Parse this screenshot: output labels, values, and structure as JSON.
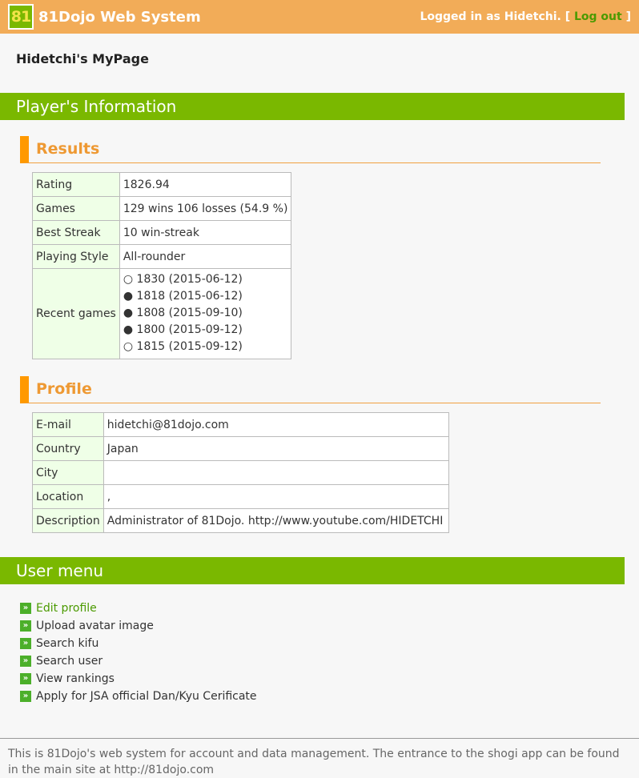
{
  "header": {
    "logo_text": "81",
    "title": "81Dojo Web System",
    "login_prefix": "Logged in as Hidetchi. [",
    "logout_label": "Log out",
    "login_suffix": "]"
  },
  "page_title": "Hidetchi's MyPage",
  "players_info": {
    "section_title": "Player's Information",
    "results": {
      "heading": "Results",
      "rows": {
        "rating": {
          "label": "Rating",
          "value": "1826.94"
        },
        "games": {
          "label": "Games",
          "value": "129 wins 106 losses (54.9 %)"
        },
        "best_streak": {
          "label": "Best Streak",
          "value": "10 win-streak"
        },
        "playing_style": {
          "label": "Playing Style",
          "value": "All-rounder"
        },
        "recent_games": {
          "label": "Recent games",
          "items": [
            {
              "result": "○",
              "text": "1830 (2015-06-12)"
            },
            {
              "result": "●",
              "text": "1818 (2015-06-12)"
            },
            {
              "result": "●",
              "text": "1808 (2015-09-10)"
            },
            {
              "result": "●",
              "text": "1800 (2015-09-12)"
            },
            {
              "result": "○",
              "text": "1815 (2015-09-12)"
            }
          ]
        }
      }
    },
    "profile": {
      "heading": "Profile",
      "rows": {
        "email": {
          "label": "E-mail",
          "value": "hidetchi@81dojo.com"
        },
        "country": {
          "label": "Country",
          "value": "Japan"
        },
        "city": {
          "label": "City",
          "value": ""
        },
        "location": {
          "label": "Location",
          "value": ","
        },
        "description": {
          "label": "Description",
          "value": "Administrator of 81Dojo. http://www.youtube.com/HIDETCHI"
        }
      }
    }
  },
  "user_menu": {
    "section_title": "User menu",
    "items": [
      {
        "label": "Edit profile"
      },
      {
        "label": "Upload avatar image"
      },
      {
        "label": "Search kifu"
      },
      {
        "label": "Search user"
      },
      {
        "label": "View rankings"
      },
      {
        "label": "Apply for JSA official Dan/Kyu Cerificate"
      }
    ]
  },
  "footer": {
    "text": "This is 81Dojo's web system for account and data management. The entrance to the shogi app can be found in the main site at http://81dojo.com"
  },
  "colors": {
    "header_bg": "#f2ac58",
    "section_bar": "#7ab800",
    "subhead_accent": "#ff9900",
    "label_cell_bg": "#efffe7",
    "link_green": "#4b9a00"
  }
}
